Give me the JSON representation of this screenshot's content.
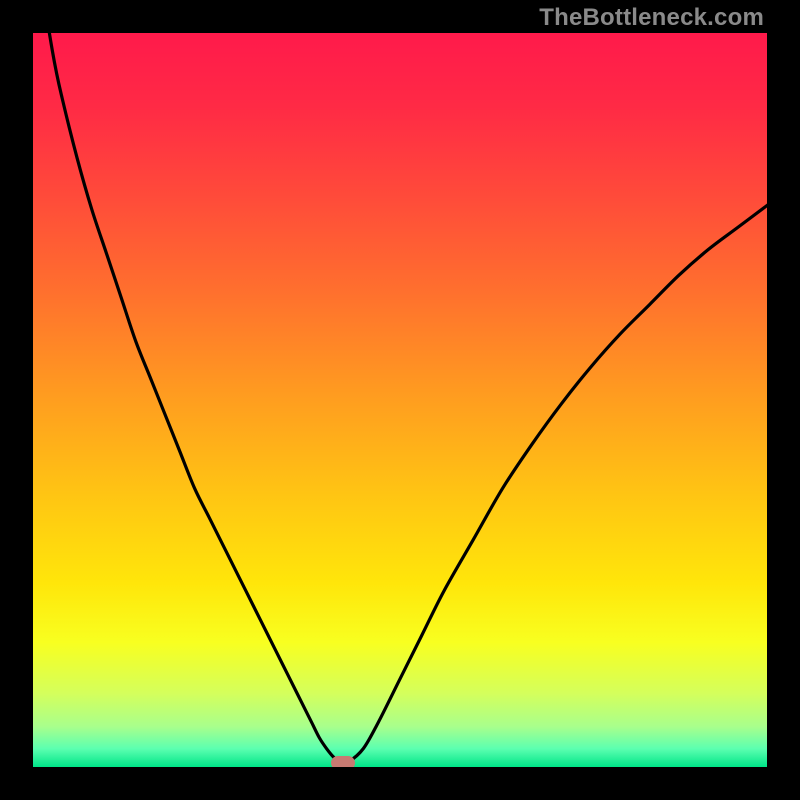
{
  "watermark": {
    "text": "TheBottleneck.com"
  },
  "colors": {
    "black": "#000000",
    "curve": "#000000",
    "marker": "#c77a72",
    "gradient_stops": [
      {
        "offset": 0.0,
        "color": "#ff1a4b"
      },
      {
        "offset": 0.1,
        "color": "#ff2a45"
      },
      {
        "offset": 0.22,
        "color": "#ff4a3a"
      },
      {
        "offset": 0.35,
        "color": "#ff6f2e"
      },
      {
        "offset": 0.5,
        "color": "#ff9e1f"
      },
      {
        "offset": 0.63,
        "color": "#ffc513"
      },
      {
        "offset": 0.75,
        "color": "#ffe60a"
      },
      {
        "offset": 0.83,
        "color": "#f8ff20"
      },
      {
        "offset": 0.9,
        "color": "#d4ff5c"
      },
      {
        "offset": 0.945,
        "color": "#a8ff8c"
      },
      {
        "offset": 0.975,
        "color": "#5cffb0"
      },
      {
        "offset": 1.0,
        "color": "#00e588"
      }
    ]
  },
  "chart_data": {
    "type": "line",
    "title": "",
    "xlabel": "",
    "ylabel": "",
    "xlim": [
      0,
      100
    ],
    "ylim": [
      0,
      100
    ],
    "grid": false,
    "x": [
      0,
      2,
      4,
      6,
      8,
      10,
      12,
      14,
      16,
      18,
      20,
      22,
      24,
      26,
      28,
      30,
      32,
      34,
      36,
      37,
      38,
      39,
      40,
      41,
      42,
      43,
      45,
      47,
      50,
      53,
      56,
      60,
      64,
      68,
      72,
      76,
      80,
      84,
      88,
      92,
      96,
      100
    ],
    "values": [
      115,
      100,
      91,
      83,
      76,
      70,
      64,
      58,
      53,
      48,
      43,
      38,
      34,
      30,
      26,
      22,
      18,
      14,
      10,
      8,
      6,
      4,
      2.5,
      1.3,
      0.6,
      0.7,
      2.5,
      6,
      12,
      18,
      24,
      31,
      38,
      44,
      49.5,
      54.5,
      59,
      63,
      67,
      70.5,
      73.5,
      76.5
    ],
    "marker": {
      "x": 42.2,
      "y": 0.6
    },
    "notes": "x is a relative parameter (0-100) along the horizontal; values are bottleneck percentage (0 at bottom, ~100 near top). Values above 100 indicate the curve starts above the visible plot top. Minimum (optimal point) is at roughly x=42, y≈0.6. Green band occupies roughly the bottom 3% of the plot height; gradient transitions continuously from red (top) through orange/yellow to green (bottom)."
  }
}
